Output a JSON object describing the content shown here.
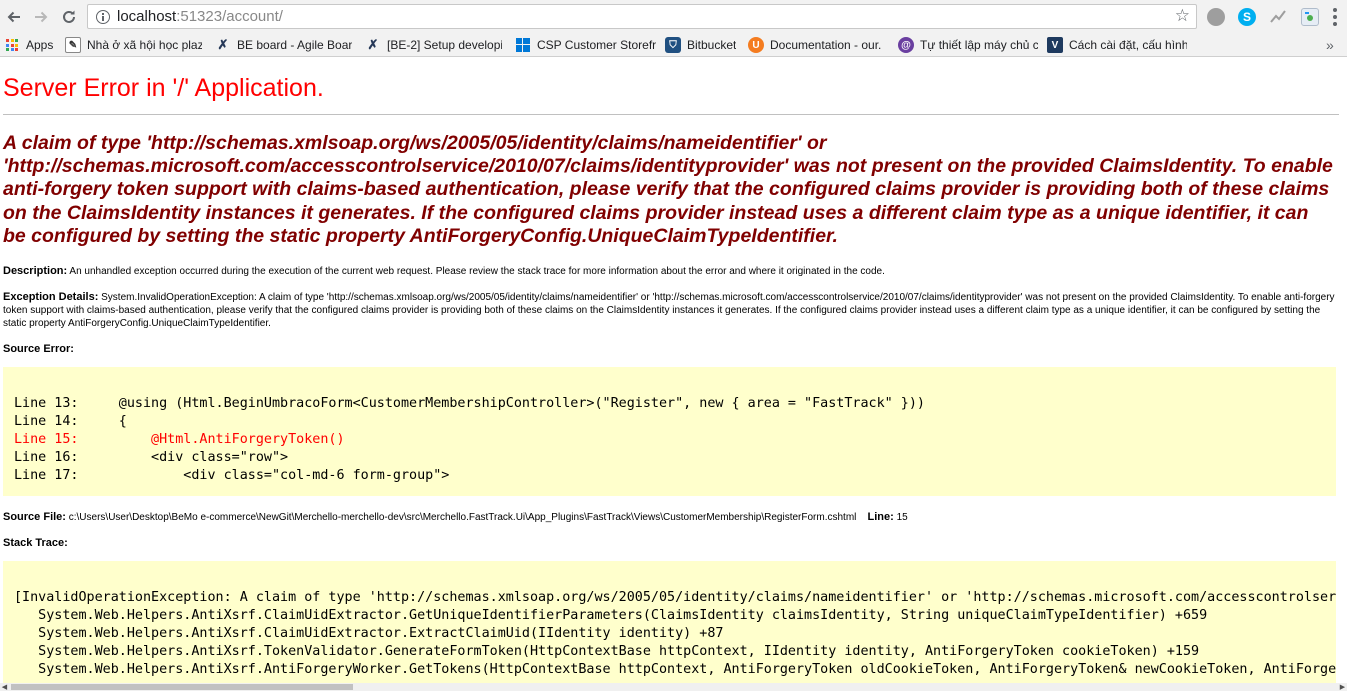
{
  "browser": {
    "url_host": "localhost",
    "url_rest": ":51323/account/",
    "bookmarks": [
      {
        "label": "Apps"
      },
      {
        "label": "Nhà ở xã hội học plaz"
      },
      {
        "label": "BE board - Agile Boar"
      },
      {
        "label": "[BE-2] Setup developi"
      },
      {
        "label": "CSP Customer Storefr"
      },
      {
        "label": "Bitbucket"
      },
      {
        "label": "Documentation - our."
      },
      {
        "label": "Tự thiết lập máy chủ c"
      },
      {
        "label": "Cách cài đặt, cấu hình"
      }
    ],
    "more_label": "»"
  },
  "page": {
    "title": "Server Error in '/' Application.",
    "message": "A claim of type 'http://schemas.xmlsoap.org/ws/2005/05/identity/claims/nameidentifier' or 'http://schemas.microsoft.com/accesscontrolservice/2010/07/claims/identityprovider' was not present on the provided ClaimsIdentity. To enable anti-forgery token support with claims-based authentication, please verify that the configured claims provider is providing both of these claims on the ClaimsIdentity instances it generates. If the configured claims provider instead uses a different claim type as a unique identifier, it can be configured by setting the static property AntiForgeryConfig.UniqueClaimTypeIdentifier.",
    "description_label": "Description:",
    "description_text": "An unhandled exception occurred during the execution of the current web request. Please review the stack trace for more information about the error and where it originated in the code.",
    "exception_label": "Exception Details:",
    "exception_text": "System.InvalidOperationException: A claim of type 'http://schemas.xmlsoap.org/ws/2005/05/identity/claims/nameidentifier' or 'http://schemas.microsoft.com/accesscontrolservice/2010/07/claims/identityprovider' was not present on the provided ClaimsIdentity. To enable anti-forgery token support with claims-based authentication, please verify that the configured claims provider is providing both of these claims on the ClaimsIdentity instances it generates. If the configured claims provider instead uses a different claim type as a unique identifier, it can be configured by setting the static property AntiForgeryConfig.UniqueClaimTypeIdentifier.",
    "source_error_label": "Source Error:",
    "source_lines": [
      {
        "text": "Line 13:     @using (Html.BeginUmbracoForm<CustomerMembershipController>(\"Register\", new { area = \"FastTrack\" }))"
      },
      {
        "text": "Line 14:     {"
      },
      {
        "text": "Line 15:         @Html.AntiForgeryToken()"
      },
      {
        "text": "Line 16:         <div class=\"row\">"
      },
      {
        "text": "Line 17:             <div class=\"col-md-6 form-group\">"
      }
    ],
    "source_file_label": "Source File:",
    "source_file_path": "c:\\Users\\User\\Desktop\\BeMo e-commerce\\NewGit\\Merchello-merchello-dev\\src\\Merchello.FastTrack.Ui\\App_Plugins\\FastTrack\\Views\\CustomerMembership\\RegisterForm.cshtml",
    "line_label": "Line:",
    "line_number": "15",
    "stack_trace_label": "Stack Trace:",
    "stack_lines": [
      {
        "text": "[InvalidOperationException: A claim of type 'http://schemas.xmlsoap.org/ws/2005/05/identity/claims/nameidentifier' or 'http://schemas.microsoft.com/accesscontrolserv"
      },
      {
        "text": "   System.Web.Helpers.AntiXsrf.ClaimUidExtractor.GetUniqueIdentifierParameters(ClaimsIdentity claimsIdentity, String uniqueClaimTypeIdentifier) +659"
      },
      {
        "text": "   System.Web.Helpers.AntiXsrf.ClaimUidExtractor.ExtractClaimUid(IIdentity identity) +87"
      },
      {
        "text": "   System.Web.Helpers.AntiXsrf.TokenValidator.GenerateFormToken(HttpContextBase httpContext, IIdentity identity, AntiForgeryToken cookieToken) +159"
      },
      {
        "text": "   System.Web.Helpers.AntiXsrf.AntiForgeryWorker.GetTokens(HttpContextBase httpContext, AntiForgeryToken oldCookieToken, AntiForgeryToken& newCookieToken, AntiForger"
      }
    ]
  },
  "colors": {
    "title": "#ff0000",
    "message": "#800000",
    "code_background": "#ffffcc",
    "highlight_line": "#ff0000"
  },
  "icons": {
    "back": "arrow-left-icon",
    "forward": "arrow-right-icon",
    "reload": "reload-icon",
    "info": "info-icon",
    "star": "star-icon",
    "menu": "kebab-menu-icon"
  }
}
